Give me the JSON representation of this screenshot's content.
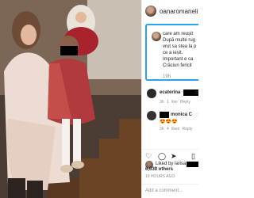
{
  "post": {
    "username": "oanaromanelis",
    "comment_lines": [
      "care am reușit",
      "După multe rug",
      "vrut sa stea la p",
      "ce a ieșit.",
      "Important e ca",
      "Crăciun fericit"
    ],
    "comment_time": "19h"
  },
  "comments": [
    {
      "name": "ecaterina",
      "meta": [
        "3h",
        "1 like",
        "Reply"
      ],
      "avatar_color": "#2a2a2a"
    },
    {
      "name": "monica C",
      "meta": [
        "3h",
        "4 likes",
        "Reply"
      ],
      "emojis": "😍😍😍",
      "avatar_color": "#333333"
    }
  ],
  "likes": {
    "prefix": "Liked by larisa",
    "count": "6,039 others",
    "time": "19 HOURS AGO"
  },
  "add_comment_placeholder": "Add a comment...",
  "accent_color": "#29a3ee"
}
